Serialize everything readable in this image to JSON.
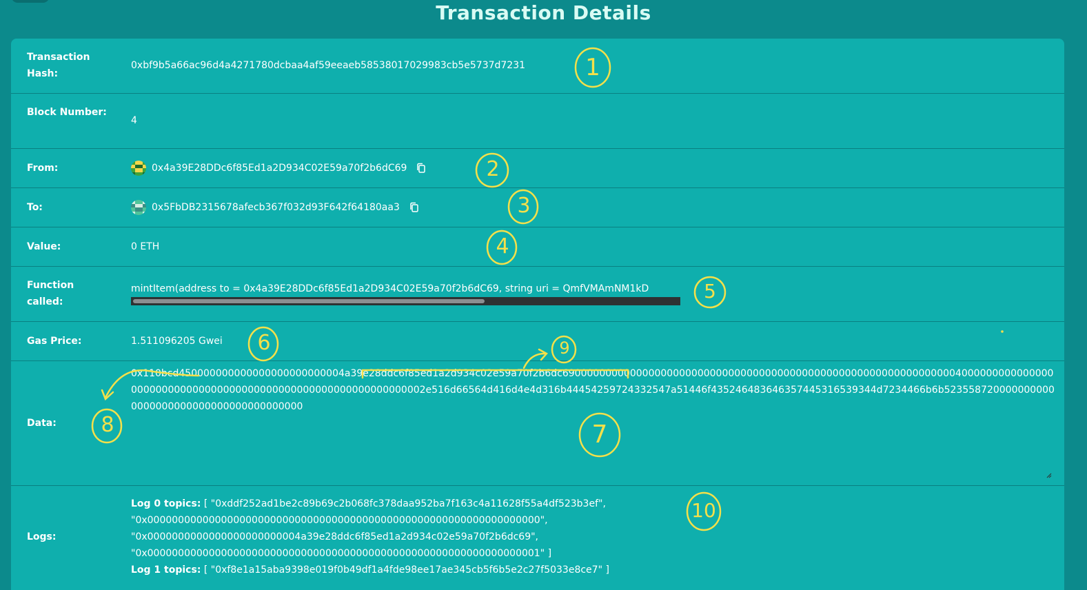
{
  "page": {
    "title": "Transaction Details"
  },
  "rows": {
    "hash": {
      "label": "Transaction Hash:",
      "value": "0xbf9b5a66ac96d4a4271780dcbaa4af59eeaeb58538017029983cb5e5737d7231"
    },
    "block": {
      "label": "Block Number:",
      "value": "4"
    },
    "from": {
      "label": "From:",
      "value": "0x4a39E28DDc6f85Ed1a2D934C02E59a70f2b6dC69"
    },
    "to": {
      "label": "To:",
      "value": "0x5FbDB2315678afecb367f032d93F642f64180aa3"
    },
    "value": {
      "label": "Value:",
      "value": "0 ETH"
    },
    "function": {
      "label": "Function called:",
      "value": "mintItem(address to = 0x4a39E28DDc6f85Ed1a2D934C02E59a70f2b6dC69, string uri = QmfVMAmNM1kD"
    },
    "gas": {
      "label": "Gas Price:",
      "value": "1.511096205 Gwei"
    },
    "data": {
      "label": "Data:",
      "value": "0x110bcd450000000000000000000000004a39e28ddc6f85ed1a2d934c02e59a70f2b6dc69000000000000000000000000000000000000000000000000000000000000004000000000000000000000000000000000000000000000000000000000000002e516d66564d416d4e4d316b44454259724332547a51446f435246483646357445316539344d7234466b6b5235587200000000000000000000000000000000000000"
    },
    "logs": {
      "label": "Logs:",
      "lines": [
        {
          "prefix": "Log 0 topics:",
          "text": " [ \"0xddf252ad1be2c89b69c2b068fc378daa952ba7f163c4a11628f55a4df523b3ef\","
        },
        {
          "prefix": "",
          "text": "\"0x0000000000000000000000000000000000000000000000000000000000000000\","
        },
        {
          "prefix": "",
          "text": "\"0x0000000000000000000000004a39e28ddc6f85ed1a2d934c02e59a70f2b6dc69\","
        },
        {
          "prefix": "",
          "text": "\"0x0000000000000000000000000000000000000000000000000000000000000001\" ]"
        },
        {
          "prefix": "Log 1 topics:",
          "text": " [ \"0xf8e1a15aba9398e019f0b49df1a4fde98ee17ae345cb5f6b5e2c27f5033e8ce7\" ]"
        }
      ]
    }
  },
  "annotations": [
    "1",
    "2",
    "3",
    "4",
    "5",
    "6",
    "7",
    "8",
    "9",
    "10"
  ],
  "colors": {
    "background": "#0c8a8c",
    "card": "#0fafad",
    "title": "#d9fbf4",
    "annotation": "#f4e04a"
  },
  "icons": {
    "copy": "copy-icon",
    "avatar": "blockie-avatar"
  }
}
